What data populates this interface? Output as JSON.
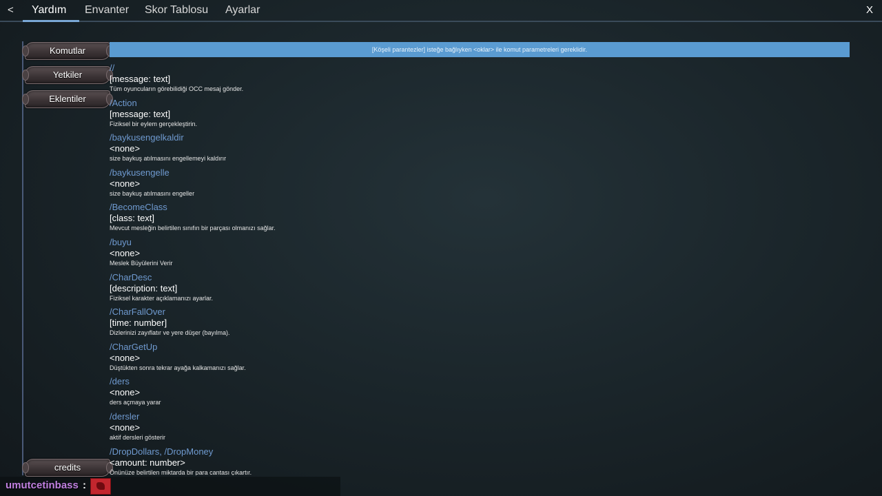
{
  "nav": {
    "back": "<",
    "close": "X",
    "tabs": [
      "Yardım",
      "Envanter",
      "Skor Tablosu",
      "Ayarlar"
    ],
    "active_tab": "Yardım"
  },
  "sidebar": {
    "buttons": [
      "Komutlar",
      "Yetkiler",
      "Eklentiler"
    ],
    "credits": "credits"
  },
  "banner": "[Köşeli parantezler] isteğe bağlıyken <oklar> ile komut parametreleri gereklidir.",
  "commands": [
    {
      "name": "//",
      "params": "[message: text]",
      "desc": "Tüm oyuncuların görebilidiği OCC mesaj gönder."
    },
    {
      "name": "/Action",
      "params": "[message: text]",
      "desc": "Fiziksel bir eylem gerçekleştirin."
    },
    {
      "name": "/baykusengelkaldir",
      "params": "<none>",
      "desc": "size baykuş atılmasını engellemeyi kaldırır"
    },
    {
      "name": "/baykusengelle",
      "params": "<none>",
      "desc": "size baykuş atılmasını engeller"
    },
    {
      "name": "/BecomeClass",
      "params": "[class: text]",
      "desc": "Mevcut mesleğin belirtilen sınıfın bir parçası olmanızı sağlar."
    },
    {
      "name": "/buyu",
      "params": "<none>",
      "desc": "Meslek Büyülerini Verir"
    },
    {
      "name": "/CharDesc",
      "params": "[description: text]",
      "desc": "Fiziksel karakter açıklamanızı ayarlar."
    },
    {
      "name": "/CharFallOver",
      "params": "[time: number]",
      "desc": "Dizlerinizi zayıflatır ve yere düşer (bayılma)."
    },
    {
      "name": "/CharGetUp",
      "params": "<none>",
      "desc": "Düştükten sonra tekrar ayağa kalkamanızı sağlar."
    },
    {
      "name": "/ders",
      "params": "<none>",
      "desc": "ders açmaya yarar"
    },
    {
      "name": "/dersler",
      "params": "<none>",
      "desc": "aktif dersleri gösterir"
    },
    {
      "name": "/DropDollars, /DropMoney",
      "params": "<amount: number>",
      "desc": "Önünüze belirtilen miktarda bir para cantası çıkartır."
    }
  ],
  "chat": {
    "username": "umutcetinbass",
    "separator": ":",
    "emote_icon": "red-emote-icon"
  },
  "colors": {
    "accent": "#5a9bd1",
    "command_name": "#6f9ad0",
    "username": "#c080e0"
  }
}
